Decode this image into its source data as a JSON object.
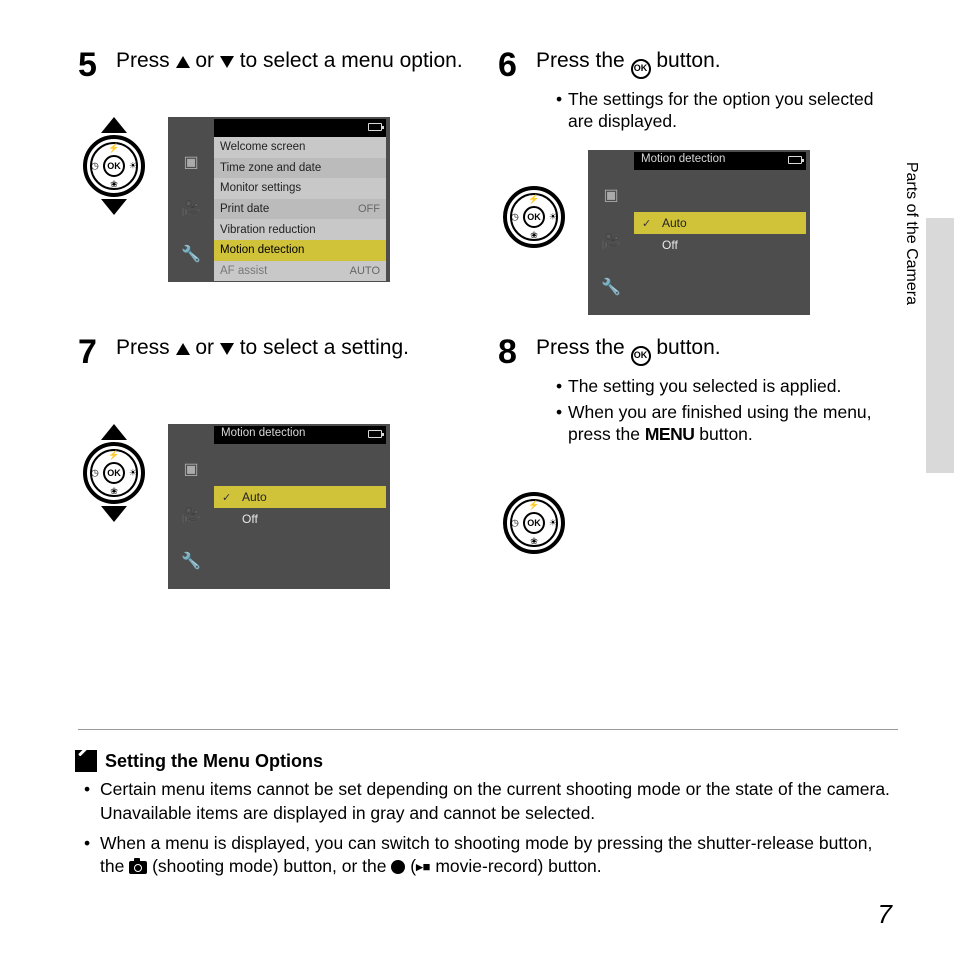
{
  "sideLabel": "Parts of the Camera",
  "pageNumber": "7",
  "steps": {
    "s5": {
      "num": "5",
      "text_a": "Press ",
      "text_b": " or ",
      "text_c": " to select a menu option."
    },
    "s6": {
      "num": "6",
      "text_a": "Press the ",
      "text_b": " button.",
      "bullet1": "The settings for the option you selected are displayed."
    },
    "s7": {
      "num": "7",
      "text_a": "Press ",
      "text_b": " or ",
      "text_c": " to select a setting."
    },
    "s8": {
      "num": "8",
      "text_a": "Press the ",
      "text_b": " button.",
      "bullet1": "The setting you selected is applied.",
      "bullet2_a": "When you are finished using the menu, press the ",
      "bullet2_b": " button.",
      "menu_word": "MENU"
    }
  },
  "lcd5": {
    "title": "",
    "items": [
      {
        "label": "Welcome screen",
        "value": ""
      },
      {
        "label": "Time zone and date",
        "value": ""
      },
      {
        "label": "Monitor settings",
        "value": ""
      },
      {
        "label": "Print date",
        "value": "OFF"
      },
      {
        "label": "Vibration reduction",
        "value": ""
      },
      {
        "label": "Motion detection",
        "value": "",
        "selected": true
      },
      {
        "label": "AF assist",
        "value": "AUTO",
        "dim": true
      }
    ]
  },
  "lcd6": {
    "title": "Motion detection",
    "auto": "Auto",
    "off": "Off"
  },
  "lcd7": {
    "title": "Motion detection",
    "auto": "Auto",
    "off": "Off"
  },
  "okLabel": "OK",
  "note": {
    "heading": "Setting the Menu Options",
    "b1": "Certain menu items cannot be set depending on the current shooting mode or the state of the camera. Unavailable items are displayed in gray and cannot be selected.",
    "b2_a": "When a menu is displayed, you can switch to shooting mode by pressing the shutter-release button, the ",
    "b2_b": " (shooting mode) button, or the ",
    "b2_c": " (",
    "b2_d": " movie-record) button."
  }
}
